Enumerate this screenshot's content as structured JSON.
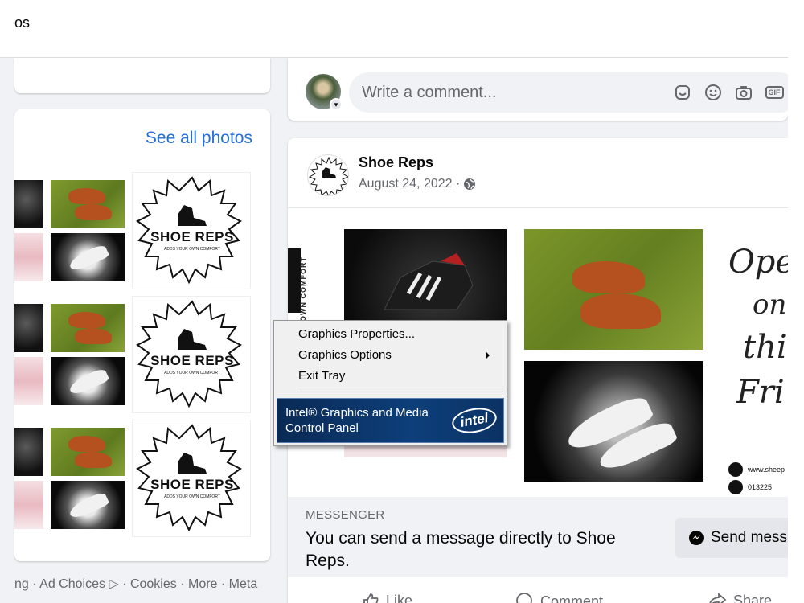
{
  "header": {
    "title_fragment": "os"
  },
  "photos": {
    "see_all_label": "See all photos",
    "logo_text": "SHOE REPS",
    "logo_tagline": "ADDS YOUR OWN COMFORT"
  },
  "footer": {
    "links": [
      "ng",
      "Ad Choices",
      "Cookies",
      "More",
      "Meta"
    ],
    "separator": " · "
  },
  "comment": {
    "placeholder": "Write a comment...",
    "icons": [
      "sticker-icon",
      "emoji-icon",
      "camera-icon",
      "gif-icon"
    ],
    "gif_label": "GIF"
  },
  "post": {
    "author": "Shoe Reps",
    "date": "August 24, 2022 ·",
    "side_text": "OWN COMFORT",
    "open_text": [
      "Open",
      "on",
      "thi",
      "Fri"
    ],
    "contact_web": "www.sheep",
    "contact_phone": "013225"
  },
  "messenger": {
    "label": "MESSENGER",
    "text": "You can send a message directly to Shoe Reps.",
    "button_label": "Send mess"
  },
  "actions": {
    "like": "Like",
    "comment": "Comment",
    "share": "Share"
  },
  "context_menu": {
    "items": [
      "Graphics Properties...",
      "Graphics Options",
      "Exit Tray"
    ],
    "banner_text": "Intel® Graphics and Media Control Panel",
    "banner_logo": "intel"
  },
  "colors": {
    "link": "#216fdb",
    "background": "#f0f2f5",
    "secondary_text": "#65676b",
    "intel_blue": "#0d3f7a"
  }
}
